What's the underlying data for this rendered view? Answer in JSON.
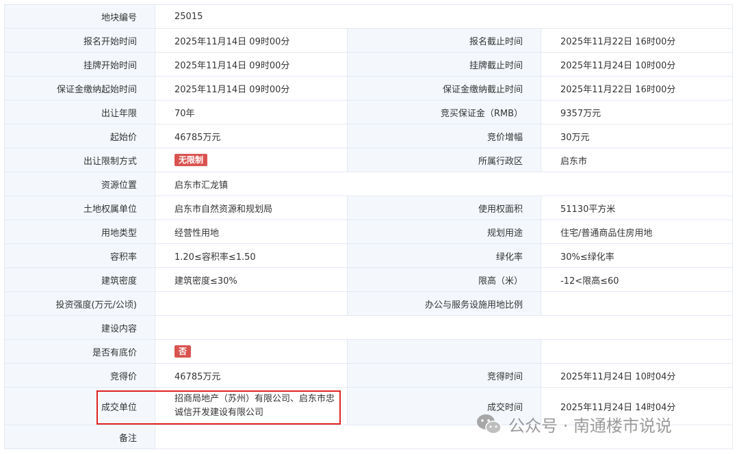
{
  "rows": [
    {
      "l1": "地块编号",
      "v1": "25015"
    },
    {
      "l1": "报名开始时间",
      "v1": "2025年11月14日 09时00分",
      "l2": "报名截止时间",
      "v2": "2025年11月22日 16时00分"
    },
    {
      "l1": "挂牌开始时间",
      "v1": "2025年11月14日 09时00分",
      "l2": "挂牌截止时间",
      "v2": "2025年11月24日 10时00分"
    },
    {
      "l1": "保证金缴纳起始时间",
      "v1": "2025年11月14日 09时00分",
      "l2": "保证金缴纳截止时间",
      "v2": "2025年11月22日 16时00分"
    },
    {
      "l1": "出让年限",
      "v1": "70年",
      "l2": "竞买保证金（RMB）",
      "v2": "9357万元"
    },
    {
      "l1": "起始价",
      "v1": "46785万元",
      "l2": "竞价增幅",
      "v2": "30万元"
    },
    {
      "l1": "出让限制方式",
      "badge": "无限制",
      "l2": "所属行政区",
      "v2": "启东市"
    },
    {
      "l1": "资源位置",
      "v1": "启东市汇龙镇"
    },
    {
      "l1": "土地权属单位",
      "v1": "启东市自然资源和规划局",
      "l2": "使用权面积",
      "v2": "51130平方米"
    },
    {
      "l1": "用地类型",
      "v1": "经营性用地",
      "l2": "规划用途",
      "v2": "住宅/普通商品住房用地"
    },
    {
      "l1": "容积率",
      "v1": "1.20≤容积率≤1.50",
      "l2": "绿化率",
      "v2": "30%≤绿化率"
    },
    {
      "l1": "建筑密度",
      "v1": "建筑密度≤30%",
      "l2": "限高（米）",
      "v2": "-12<限高≤60"
    },
    {
      "l1": "投资强度(万元/公顷)",
      "v1": "",
      "l2": "办公与服务设施用地比例",
      "v2": ""
    },
    {
      "l1": "建设内容",
      "v1": ""
    },
    {
      "l1": "是否有底价",
      "badge": "否"
    },
    {
      "l1": "竞得价",
      "v1": "46785万元",
      "l2": "竞得时间",
      "v2": "2025年11月24日 10时04分"
    },
    {
      "l1": "成交单位",
      "v1": "招商局地产（苏州）有限公司、启东市忠诚信开发建设有限公司",
      "l2": "成交时间",
      "v2": "2025年11月24日 14时04分"
    },
    {
      "l1": "备注",
      "v1": ""
    }
  ],
  "watermark": {
    "text": "公众号 · 南通楼市说说"
  },
  "colors": {
    "label_bg": "#f4f8fd",
    "border": "#e3e9f1",
    "badge": "#d9534f",
    "highlight": "#e02020"
  }
}
